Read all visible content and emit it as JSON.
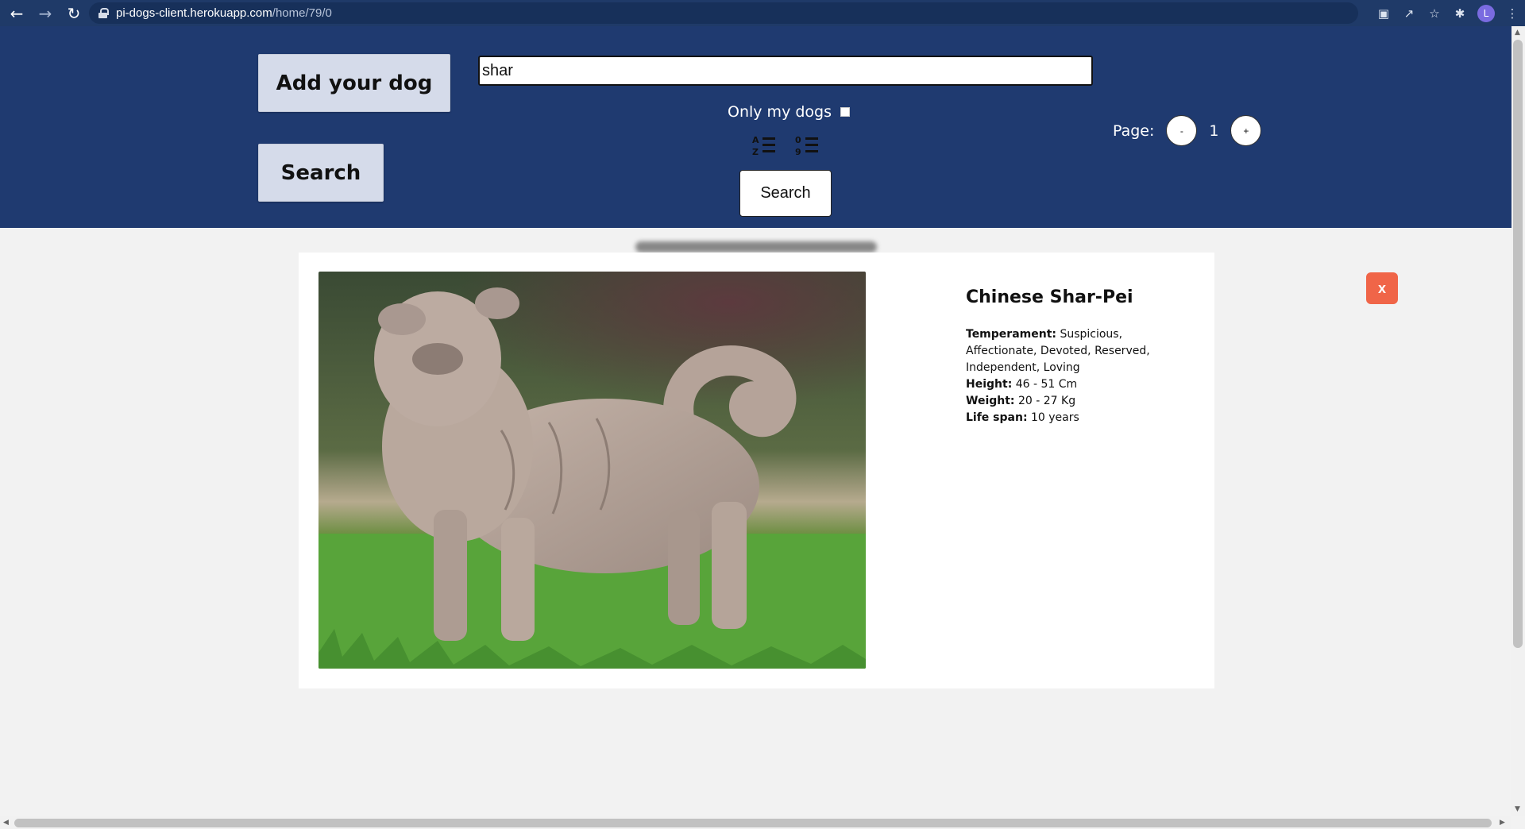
{
  "browser": {
    "url_host": "pi-dogs-client.herokuapp.com",
    "url_path": "/home/79/0",
    "avatar_letter": "L"
  },
  "header": {
    "add_dog_label": "Add your dog",
    "search_left_label": "Search",
    "search_input_value": "shar",
    "only_my_dogs_label": "Only my dogs",
    "search_center_label": "Search",
    "page_label": "Page:",
    "page_prev_label": "-",
    "page_number": "1",
    "page_next_label": "+"
  },
  "detail": {
    "name": "Chinese Shar-Pei",
    "temperament_label": "Temperament:",
    "temperament_value": "Suspicious, Affectionate, Devoted, Reserved, Independent, Loving",
    "height_label": "Height:",
    "height_value": "46 - 51 Cm",
    "weight_label": "Weight:",
    "weight_value": "20 - 27 Kg",
    "lifespan_label": "Life span:",
    "lifespan_value": "10 years",
    "close_label": "x"
  },
  "colors": {
    "header_bg": "#1f3a70",
    "close_btn": "#f06548",
    "btn_bg": "#d5dbea"
  }
}
